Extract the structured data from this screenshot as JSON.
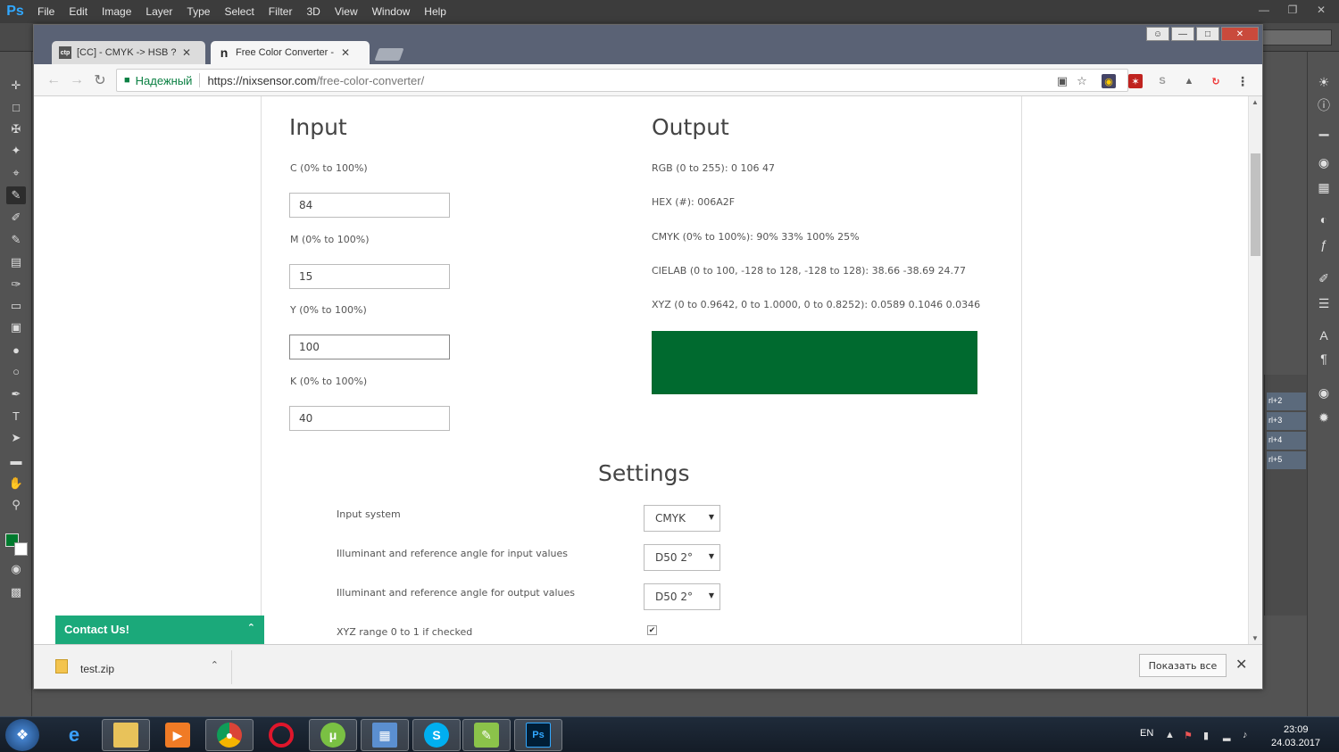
{
  "ps": {
    "logo": "Ps",
    "menu": [
      "File",
      "Edit",
      "Image",
      "Layer",
      "Type",
      "Select",
      "Filter",
      "3D",
      "View",
      "Window",
      "Help"
    ],
    "panel_rows": [
      "rl+2",
      "rl+3",
      "rl+4",
      "rl+5"
    ]
  },
  "browser": {
    "tabs": [
      {
        "favicon": "ctp",
        "title": "[CC] - CMYK -> HSB ? | C"
      },
      {
        "favicon": "n",
        "title": "Free Color Converter - R"
      }
    ],
    "secure_label": "Надежный",
    "url_host": "https://nixsensor.com",
    "url_path": "/free-color-converter/"
  },
  "page": {
    "input": {
      "heading": "Input",
      "fields": [
        {
          "label": "C (0% to 100%)",
          "value": "84"
        },
        {
          "label": "M (0% to 100%)",
          "value": "15"
        },
        {
          "label": "Y (0% to 100%)",
          "value": "100"
        },
        {
          "label": "K (0% to 100%)",
          "value": "40"
        }
      ]
    },
    "output": {
      "heading": "Output",
      "lines": [
        "RGB (0 to 255): 0 106 47",
        "HEX (#): 006A2F",
        "CMYK (0% to 100%): 90% 33% 100% 25%",
        "CIELAB (0 to 100, -128 to 128, -128 to 128): 38.66 -38.69 24.77",
        "XYZ (0 to 0.9642, 0 to 1.0000, 0 to 0.8252): 0.0589 0.1046 0.0346"
      ],
      "preview_color": "#006A2F"
    },
    "settings": {
      "heading": "Settings",
      "rows": [
        {
          "label": "Input system",
          "value": "CMYK"
        },
        {
          "label": "Illuminant and reference angle for input values",
          "value": "D50 2°"
        },
        {
          "label": "Illuminant and reference angle for output values",
          "value": "D50 2°"
        }
      ],
      "checkbox_label": "XYZ range 0 to 1 if checked",
      "checkbox_checked": true
    },
    "contact": "Contact Us!"
  },
  "downloads": {
    "file": "test.zip",
    "show_all": "Показать все"
  },
  "taskbar": {
    "lang": "EN",
    "time": "23:09",
    "date": "24.03.2017"
  },
  "colors": {
    "ps_accent": "#31a8ff",
    "secure_green": "#0b8043",
    "contact_green": "#1ba97a",
    "foreground_swatch": "#007a2e"
  }
}
